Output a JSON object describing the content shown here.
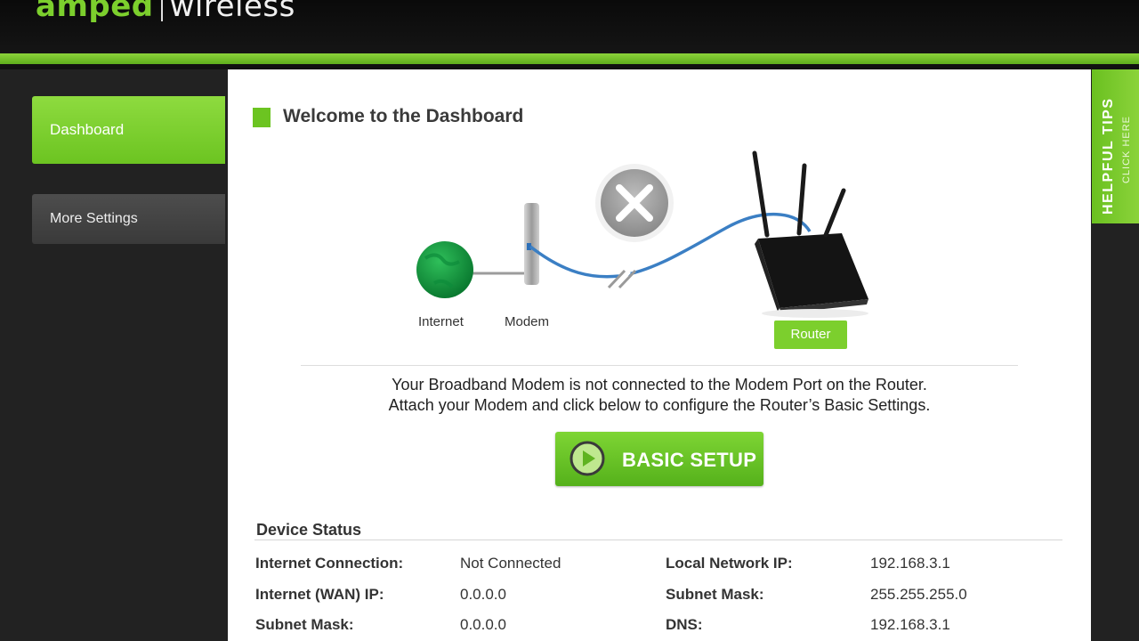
{
  "brand": {
    "name_left": "amped",
    "name_right": "wireless"
  },
  "nav": {
    "dashboard": "Dashboard",
    "more_settings": "More Settings"
  },
  "page": {
    "title": "Welcome to the Dashboard"
  },
  "diagram": {
    "internet_label": "Internet",
    "modem_label": "Modem",
    "router_label": "Router",
    "status_icon": "x-circle-icon",
    "connection_state": "disconnected"
  },
  "message": {
    "line1": "Your Broadband Modem is not connected to the Modem Port on the Router.",
    "line2": "Attach your Modem and click below to configure the Router’s Basic Settings."
  },
  "setup_button": {
    "label": "BASIC SETUP",
    "icon": "play-circle-icon"
  },
  "device_status": {
    "heading": "Device Status",
    "rows": [
      {
        "label": "Internet Connection:",
        "value": "Not Connected",
        "label2": "Local Network IP:",
        "value2": "192.168.3.1"
      },
      {
        "label": "Internet (WAN) IP:",
        "value": "0.0.0.0",
        "label2": "Subnet Mask:",
        "value2": "255.255.255.0"
      },
      {
        "label": "Subnet Mask:",
        "value": "0.0.0.0",
        "label2": "DNS:",
        "value2": "192.168.3.1"
      }
    ]
  },
  "tips": {
    "title": "HELPFUL TIPS",
    "subtitle": "CLICK HERE"
  },
  "colors": {
    "accent": "#7ccf2d",
    "background": "#222222",
    "panel": "#ffffff",
    "cable": "#3b7fc4"
  }
}
